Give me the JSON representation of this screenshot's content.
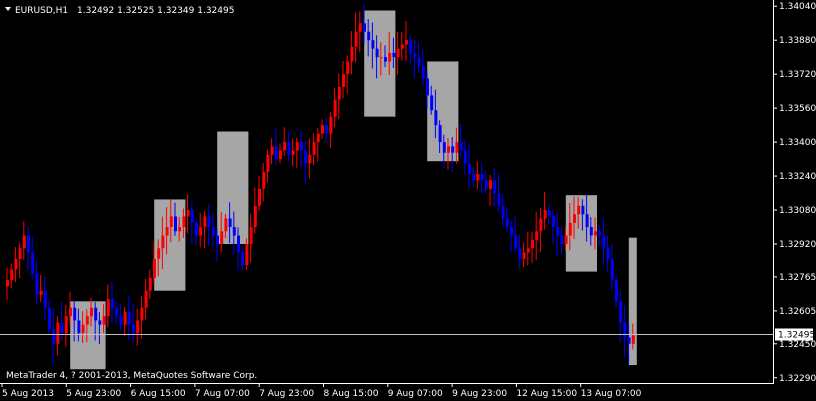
{
  "window": {
    "title_symbol": "EURUSD,H1",
    "ohlc": "1.32492 1.32525 1.32349 1.32495",
    "footer": "MetaTrader 4, ? 2001-2013, MetaQuotes Software Corp."
  },
  "colors": {
    "background": "#000000",
    "bull_candle": "#ff0000",
    "bear_candle": "#0000ff",
    "highlight_box": "#a6a6a6",
    "price_line": "#c0c0c0",
    "axis_text": "#ffffff"
  },
  "chart_data": {
    "type": "candlestick",
    "symbol": "EURUSD",
    "timeframe": "H1",
    "y_ticks": [
      "1.34040",
      "1.33880",
      "1.33720",
      "1.33560",
      "1.33400",
      "1.33240",
      "1.33080",
      "1.32920",
      "1.32765",
      "1.32605",
      "1.32450",
      "1.32290"
    ],
    "ylim": [
      1.3227,
      1.3406
    ],
    "x_ticks": [
      "5 Aug 2013",
      "5 Aug 23:00",
      "6 Aug 15:00",
      "7 Aug 07:00",
      "7 Aug 23:00",
      "8 Aug 15:00",
      "9 Aug 07:00",
      "9 Aug 23:00",
      "12 Aug 15:00",
      "13 Aug 07:00"
    ],
    "current_price": "1.32495",
    "current_price_value": 1.32495,
    "highlight_zones": [
      {
        "start": "5 Aug 2013 16:00",
        "end": "5 Aug 2013 23:00",
        "low": 1.3233,
        "high": 1.3265
      },
      {
        "start": "6 Aug 2013 12:00",
        "end": "6 Aug 2013 18:00",
        "low": 1.327,
        "high": 1.3313
      },
      {
        "start": "7 Aug 2013 03:00",
        "end": "7 Aug 2013 09:00",
        "low": 1.3292,
        "high": 1.3345
      },
      {
        "start": "8 Aug 2013 14:00",
        "end": "8 Aug 2013 20:00",
        "low": 1.3352,
        "high": 1.3402
      },
      {
        "start": "9 Aug 2013 05:00",
        "end": "9 Aug 2013 11:00",
        "low": 1.3331,
        "high": 1.3378
      },
      {
        "start": "12 Aug 2013 14:00",
        "end": "12 Aug 2013 20:00",
        "low": 1.3279,
        "high": 1.3315
      },
      {
        "start": "13 Aug 2013 11:00",
        "end": "13 Aug 2013 16:00",
        "low": 1.3235,
        "high": 1.3295
      }
    ],
    "closes": [
      1.3275,
      1.328,
      1.3285,
      1.329,
      1.3296,
      1.3288,
      1.3278,
      1.3268,
      1.327,
      1.3262,
      1.3252,
      1.3245,
      1.3255,
      1.325,
      1.3258,
      1.3262,
      1.3256,
      1.325,
      1.3254,
      1.3258,
      1.3262,
      1.3256,
      1.3254,
      1.3258,
      1.3266,
      1.3262,
      1.3258,
      1.3254,
      1.326,
      1.3254,
      1.325,
      1.3256,
      1.3262,
      1.327,
      1.3276,
      1.3285,
      1.329,
      1.3296,
      1.33,
      1.3305,
      1.3298,
      1.33,
      1.3305,
      1.3308,
      1.3302,
      1.3296,
      1.33,
      1.3305,
      1.33,
      1.3296,
      1.3292,
      1.3298,
      1.3304,
      1.33,
      1.3296,
      1.3288,
      1.3282,
      1.3292,
      1.33,
      1.331,
      1.3318,
      1.3326,
      1.3334,
      1.3338,
      1.3332,
      1.3336,
      1.334,
      1.3334,
      1.3336,
      1.334,
      1.3336,
      1.333,
      1.3334,
      1.334,
      1.3344,
      1.3348,
      1.3344,
      1.3352,
      1.336,
      1.3366,
      1.3372,
      1.3378,
      1.3385,
      1.3392,
      1.3396,
      1.3392,
      1.3388,
      1.3384,
      1.338,
      1.338,
      1.3378,
      1.3382,
      1.338,
      1.3384,
      1.3386,
      1.3388,
      1.3382,
      1.338,
      1.3376,
      1.337,
      1.3362,
      1.3355,
      1.3348,
      1.334,
      1.3335,
      1.3338,
      1.3335,
      1.334,
      1.3336,
      1.333,
      1.3325,
      1.3322,
      1.3325,
      1.3322,
      1.3318,
      1.3322,
      1.3316,
      1.331,
      1.3304,
      1.33,
      1.3296,
      1.329,
      1.3285,
      1.3288,
      1.329,
      1.3294,
      1.3298,
      1.3304,
      1.3308,
      1.3305,
      1.33,
      1.3296,
      1.3292,
      1.3296,
      1.3302,
      1.3306,
      1.331,
      1.3306,
      1.33,
      1.3296,
      1.3298,
      1.3296,
      1.329,
      1.3285,
      1.3275,
      1.3265,
      1.3255,
      1.3248,
      1.3245,
      1.3249
    ],
    "start_time": "5 Aug 2013 00:00",
    "interval": "1 hour"
  }
}
